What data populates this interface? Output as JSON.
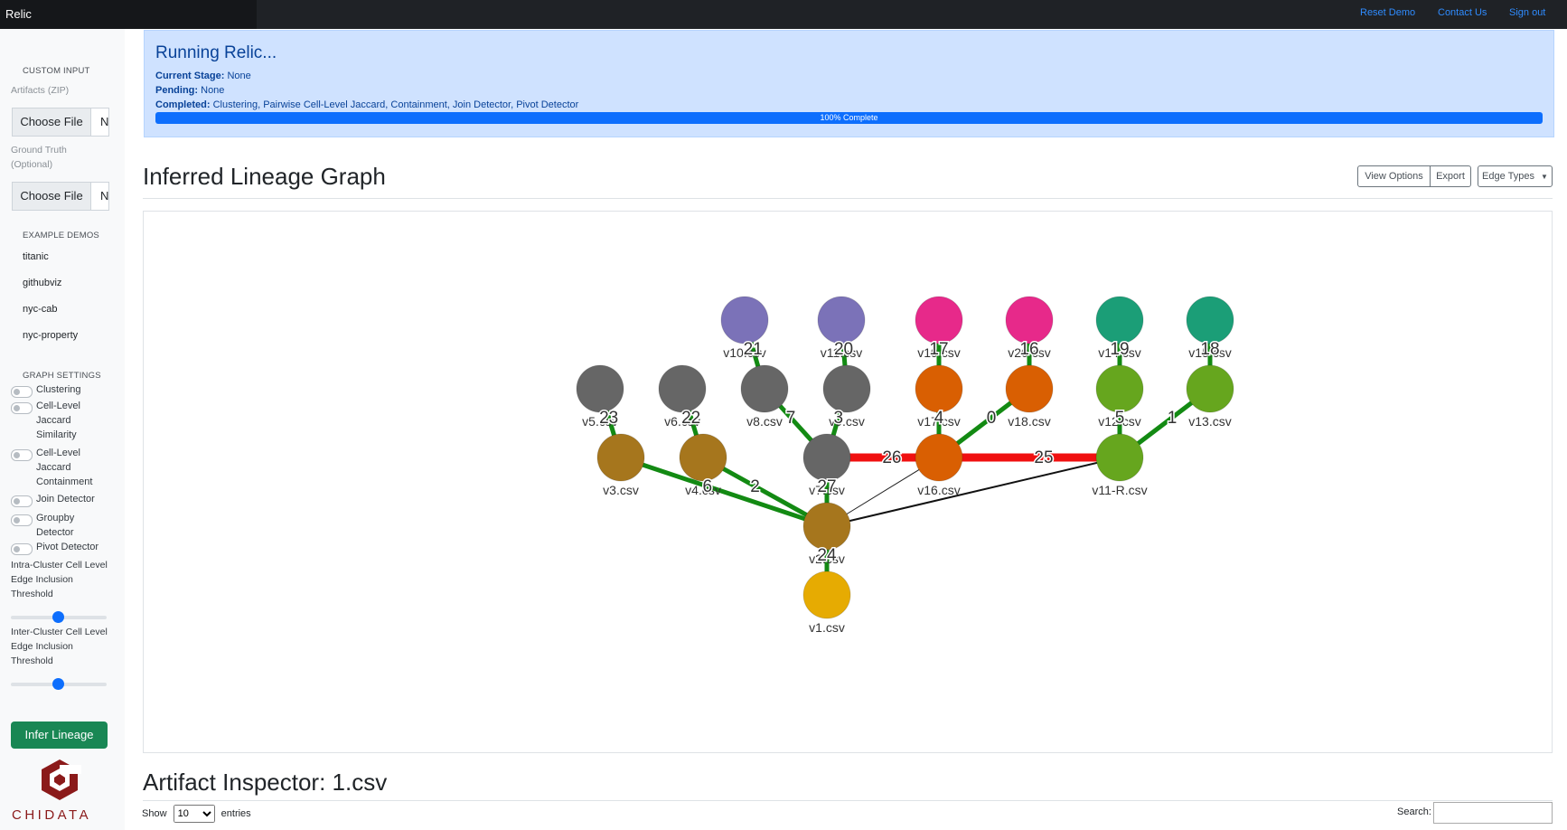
{
  "app": {
    "brand": "Relic",
    "nav": [
      "Reset Demo",
      "Contact Us",
      "Sign out"
    ]
  },
  "sidebar": {
    "custom_input_heading": "CUSTOM INPUT",
    "artifacts_label": "Artifacts (ZIP)",
    "ground_truth_label": "Ground Truth (Optional)",
    "choose_file_label": "Choose File",
    "file_status": "N",
    "example_demos_heading": "EXAMPLE DEMOS",
    "demos": [
      "titanic",
      "githubviz",
      "nyc-cab",
      "nyc-property"
    ],
    "graph_settings_heading": "GRAPH SETTINGS",
    "toggles": [
      "Clustering",
      "Cell-Level Jaccard Similarity",
      "Cell-Level Jaccard Containment",
      "Join Detector",
      "Groupby Detector",
      "Pivot Detector"
    ],
    "intra_label": "Intra-Cluster Cell Level Edge Inclusion Threshold",
    "intra_value": 0.5,
    "inter_label": "Inter-Cluster Cell Level Edge Inclusion Threshold",
    "inter_value": 0.5,
    "infer_button": "Infer Lineage",
    "logo_text": "CHIDATA"
  },
  "status": {
    "title": "Running Relic...",
    "current_stage_label": "Current Stage:",
    "current_stage": "None",
    "pending_label": "Pending:",
    "pending": "None",
    "completed_label": "Completed:",
    "completed": "Clustering, Pairwise Cell-Level Jaccard, Containment, Join Detector, Pivot Detector",
    "progress_text": "100% Complete",
    "progress_value": 100
  },
  "graph_section": {
    "title": "Inferred Lineage Graph",
    "view_options": "View Options",
    "export": "Export",
    "edge_types": "Edge Types"
  },
  "graph": {
    "nodes": [
      {
        "id": "v10",
        "label": "v10.csv",
        "color": "#7b72b8"
      },
      {
        "id": "v11",
        "label": "v11.csv",
        "color": "#7b72b8"
      },
      {
        "id": "v19",
        "label": "v19.csv",
        "color": "#e7298a"
      },
      {
        "id": "v20",
        "label": "v20.csv",
        "color": "#e7298a"
      },
      {
        "id": "v14",
        "label": "v14.csv",
        "color": "#1b9e77"
      },
      {
        "id": "v15",
        "label": "v15.csv",
        "color": "#1b9e77"
      },
      {
        "id": "v5",
        "label": "v5.csv",
        "color": "#666666"
      },
      {
        "id": "v6",
        "label": "v6.csv",
        "color": "#666666"
      },
      {
        "id": "v8",
        "label": "v8.csv",
        "color": "#666666"
      },
      {
        "id": "v9",
        "label": "v9.csv",
        "color": "#666666"
      },
      {
        "id": "v17",
        "label": "v17.csv",
        "color": "#d95f02"
      },
      {
        "id": "v18",
        "label": "v18.csv",
        "color": "#d95f02"
      },
      {
        "id": "v12",
        "label": "v12.csv",
        "color": "#66a61e"
      },
      {
        "id": "v13",
        "label": "v13.csv",
        "color": "#66a61e"
      },
      {
        "id": "v3",
        "label": "v3.csv",
        "color": "#a6761d"
      },
      {
        "id": "v4",
        "label": "v4.csv",
        "color": "#a6761d"
      },
      {
        "id": "v7",
        "label": "v7.csv",
        "color": "#666666"
      },
      {
        "id": "v16",
        "label": "v16.csv",
        "color": "#d95f02"
      },
      {
        "id": "v11R",
        "label": "v11-R.csv",
        "color": "#66a61e"
      },
      {
        "id": "v2",
        "label": "v2.csv",
        "color": "#a6761d"
      },
      {
        "id": "v1",
        "label": "v1.csv",
        "color": "#e6ab02"
      }
    ],
    "edges": [
      {
        "from": "v10",
        "to": "v8",
        "label": "21",
        "type": "green"
      },
      {
        "from": "v11",
        "to": "v9",
        "label": "20",
        "type": "green"
      },
      {
        "from": "v19",
        "to": "v17",
        "label": "17",
        "type": "green"
      },
      {
        "from": "v20",
        "to": "v18",
        "label": "16",
        "type": "green"
      },
      {
        "from": "v14",
        "to": "v12",
        "label": "19",
        "type": "green"
      },
      {
        "from": "v15",
        "to": "v13",
        "label": "18",
        "type": "green"
      },
      {
        "from": "v5",
        "to": "v3",
        "label": "23",
        "type": "green"
      },
      {
        "from": "v6",
        "to": "v4",
        "label": "22",
        "type": "green"
      },
      {
        "from": "v8",
        "to": "v7",
        "label": "7",
        "type": "green"
      },
      {
        "from": "v9",
        "to": "v7",
        "label": "3",
        "type": "green"
      },
      {
        "from": "v17",
        "to": "v16",
        "label": "4",
        "type": "green"
      },
      {
        "from": "v18",
        "to": "v16",
        "label": "0",
        "type": "green"
      },
      {
        "from": "v12",
        "to": "v11R",
        "label": "5",
        "type": "green"
      },
      {
        "from": "v13",
        "to": "v11R",
        "label": "1",
        "type": "green"
      },
      {
        "from": "v7",
        "to": "v16",
        "label": "26",
        "type": "red"
      },
      {
        "from": "v16",
        "to": "v11R",
        "label": "25",
        "type": "red"
      },
      {
        "from": "v3",
        "to": "v2",
        "label": "6",
        "type": "green"
      },
      {
        "from": "v4",
        "to": "v2",
        "label": "2",
        "type": "green"
      },
      {
        "from": "v7",
        "to": "v2",
        "label": "27",
        "type": "green"
      },
      {
        "from": "v16",
        "to": "v2",
        "label": "",
        "type": "thin"
      },
      {
        "from": "v11R",
        "to": "v2",
        "label": "",
        "type": "black"
      },
      {
        "from": "v2",
        "to": "v1",
        "label": "24",
        "type": "green"
      }
    ]
  },
  "inspector": {
    "title": "Artifact Inspector: 1.csv",
    "show_label": "Show",
    "entries_value": "10",
    "entries_label": "entries",
    "search_label": "Search:"
  }
}
